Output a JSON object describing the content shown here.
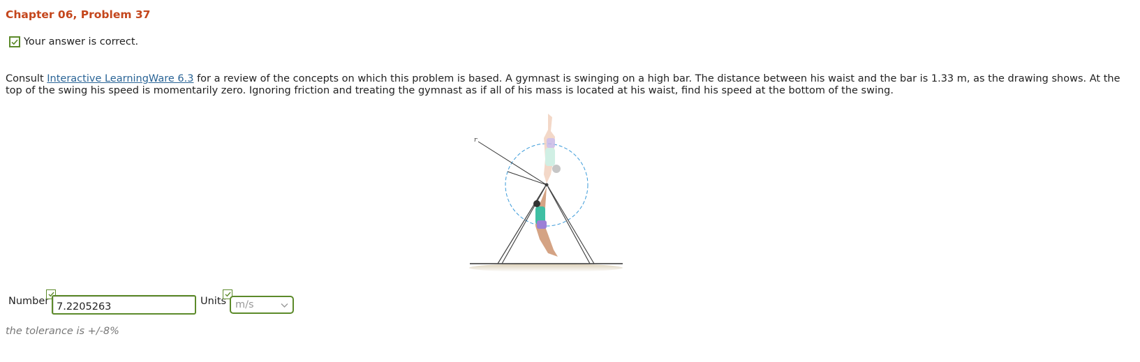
{
  "problem": {
    "title": "Chapter 06, Problem 37",
    "status_text": "Your answer is correct.",
    "text_before_link": "Consult ",
    "link_text": "Interactive LearningWare 6.3",
    "text_after_link": " for a review of the concepts on which this problem is based. A gymnast is swinging on a high bar. The distance between his waist and the bar is 1.33 m, as the drawing shows. At the top of the swing his speed is momentarily zero. Ignoring friction and treating the gymnast as if all of his mass is located at his waist, find his speed at the bottom of the swing."
  },
  "figure": {
    "radius_label": "r"
  },
  "answer": {
    "number_label": "Number",
    "number_value": "7.2205263",
    "units_label": "Units",
    "units_value": "m/s",
    "tolerance_text": "the tolerance is +/-8%"
  },
  "colors": {
    "title": "#c4461c",
    "correct_green": "#5c8a2a",
    "link": "#2a6496"
  },
  "icons": {
    "status": "checkmark-icon",
    "number_status": "checkmark-icon",
    "units_status": "checkmark-icon",
    "units_dropdown": "chevron-down-icon"
  }
}
